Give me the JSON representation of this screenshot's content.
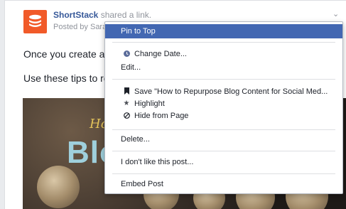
{
  "post": {
    "page_name": "ShortStack",
    "action": "shared a link.",
    "posted_by": "Posted by Sara",
    "line1": "Once you create a bl",
    "line2": "Use these tips to rep",
    "image_text_small": "How",
    "image_text_big": "Blo"
  },
  "menu": {
    "items": [
      {
        "label": "Pin to Top"
      },
      {
        "label": "Change Date...",
        "icon": "clock-icon"
      },
      {
        "label": "Edit..."
      },
      {
        "label": "Save \"How to Repurpose Blog Content for Social Med...",
        "icon": "bookmark-icon"
      },
      {
        "label": "Highlight",
        "icon": "star-icon"
      },
      {
        "label": "Hide from Page",
        "icon": "hide-icon"
      },
      {
        "label": "Delete..."
      },
      {
        "label": "I don't like this post..."
      },
      {
        "label": "Embed Post"
      }
    ]
  },
  "colors": {
    "brand": "#f15a29",
    "link": "#365899",
    "selected": "#4267b2"
  }
}
